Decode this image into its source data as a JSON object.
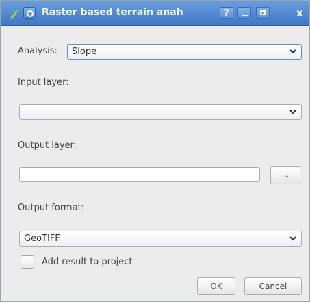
{
  "window": {
    "title": "Raster based terrain anah",
    "help_label": "?",
    "close_label": "x"
  },
  "form": {
    "analysis_label": "Analysis:",
    "analysis_value": "Slope",
    "input_layer_label": "Input layer:",
    "input_layer_value": "",
    "output_layer_label": "Output layer:",
    "output_layer_value": "",
    "browse_label": "...",
    "output_format_label": "Output format:",
    "output_format_value": "GeoTIFF",
    "add_result_label": "Add result to project",
    "add_result_checked": false
  },
  "buttons": {
    "ok_label": "OK",
    "cancel_label": "Cancel"
  },
  "colors": {
    "titlebar": "#3d78c8",
    "accent_border": "#5d8fd0",
    "background": "#ececec"
  }
}
